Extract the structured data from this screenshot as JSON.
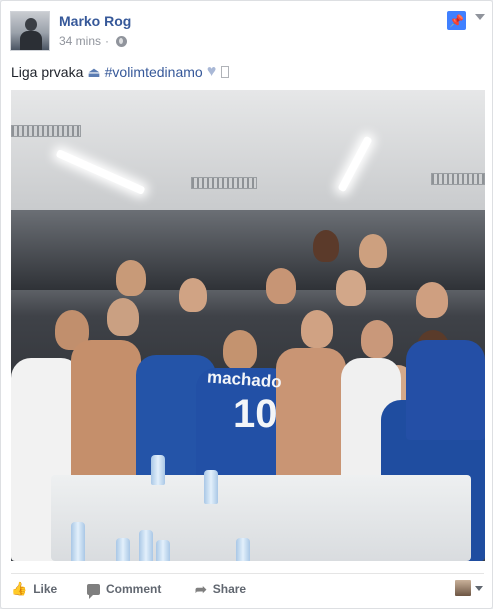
{
  "post": {
    "author": "Marko Rog",
    "time": "34 mins",
    "separator": "·",
    "text_prefix": "Liga prvaka",
    "hashtag": "#volimtedinamo",
    "photo_jersey_name": "machado",
    "photo_jersey_number": "10"
  },
  "icons": {
    "privacy": "globe-icon",
    "pin": "pin-icon",
    "menu": "chevron-down-icon",
    "emoji_1": "iron-icon",
    "emoji_2": "heart-icon"
  },
  "actions": {
    "like": "Like",
    "comment": "Comment",
    "share": "Share"
  },
  "colors": {
    "link": "#365899",
    "pin_bg": "#4080ff",
    "muted": "#90949c",
    "action_text": "#616770"
  }
}
